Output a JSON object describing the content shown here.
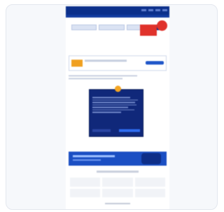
{
  "site": {
    "logo_text": "",
    "hero": {
      "title": "",
      "subtitle": ""
    },
    "badge_text": ""
  },
  "modal": {
    "logo_text": "",
    "close_text": ""
  },
  "colors": {
    "brand": "#0b2f8a",
    "accent": "#e0322b",
    "modal_bg": "#10287a",
    "cta": "#2f6df0",
    "cursor": "#f4a522"
  },
  "icons": [
    "logo-icon",
    "close-icon",
    "cursor-icon"
  ]
}
